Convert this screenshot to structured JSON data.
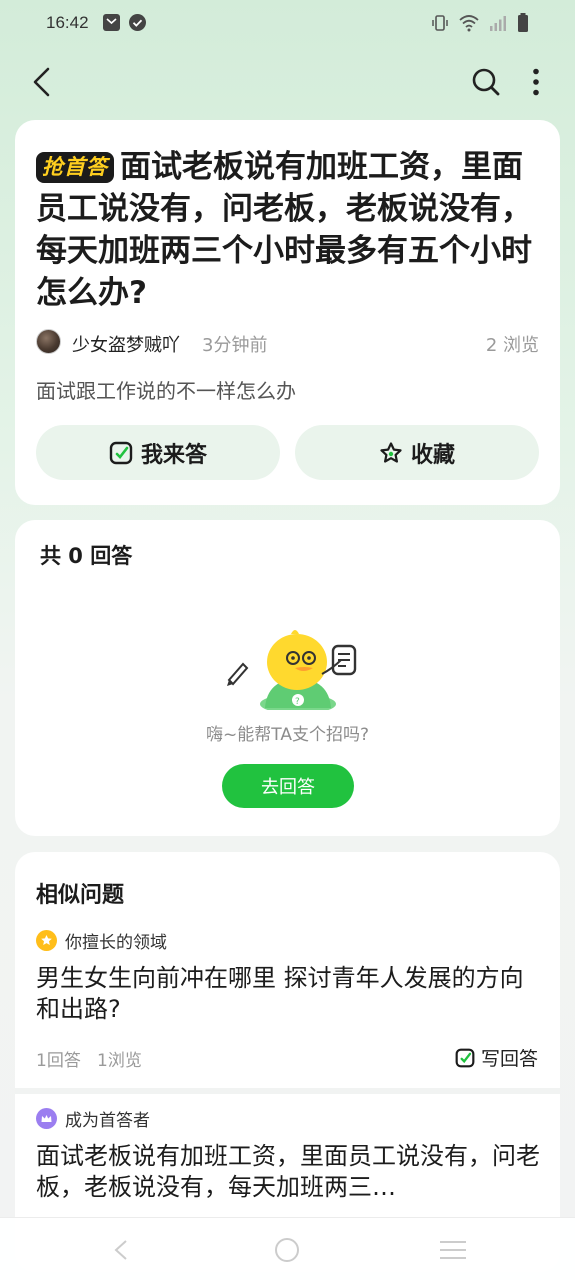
{
  "status_bar": {
    "time": "16:42"
  },
  "question": {
    "badge": "抢首答",
    "title": "面试老板说有加班工资，里面员工说没有，问老板，老板说没有，每天加班两三个小时最多有五个小时怎么办?",
    "author": "少女盗梦贼吖",
    "time_ago": "3分钟前",
    "views": "2 浏览",
    "description": "面试跟工作说的不一样怎么办",
    "answer_button": "我来答",
    "favorite_button": "收藏"
  },
  "answers": {
    "count_label": "共 0 回答",
    "empty_text": "嗨~能帮TA支个招吗?",
    "go_answer_button": "去回答"
  },
  "similar": {
    "heading": "相似问题",
    "items": [
      {
        "tag": "你擅长的领域",
        "tag_icon": "star-badge-icon",
        "question": "男生女生向前冲在哪里 探讨青年人发展的方向和出路?",
        "answers": "1回答",
        "views": "1浏览",
        "write_label": "写回答"
      },
      {
        "tag": "成为首答者",
        "tag_icon": "crown-badge-icon",
        "question": "面试老板说有加班工资，里面员工说没有，问老板，老板说没有，每天加班两三…"
      }
    ]
  },
  "colors": {
    "accent_green": "#21c23f",
    "badge_yellow": "#ffcf1f",
    "pill_bg": "#eaf4ec"
  }
}
